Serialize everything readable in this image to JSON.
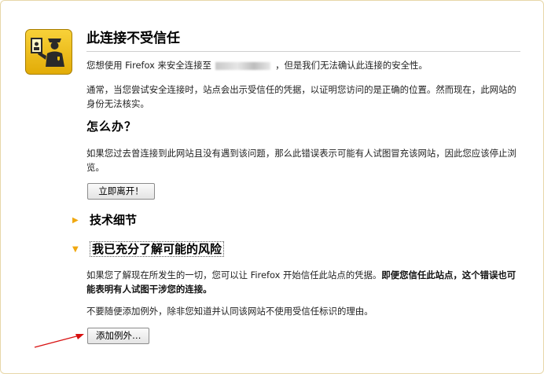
{
  "page": {
    "title": "此连接不受信任",
    "intro_before": "您想使用 Firefox 来安全连接至",
    "intro_after": "，但是我们无法确认此连接的安全性。",
    "normal_explanation": "通常，当您尝试安全连接时，站点会出示受信任的凭据，以证明您访问的是正确的位置。然而现在，此网站的身份无法核实。",
    "what_to_do_heading": "怎么办？",
    "what_to_do_text": "如果您过去曾连接到此网站且没有遇到该问题，那么此错误表示可能有人试图冒充该网站，因此您应该停止浏览。",
    "leave_button": "立即离开！",
    "technical_details": "技术细节",
    "understand_risks": "我已充分了解可能的风险",
    "risk_text_plain": "如果您了解现在所发生的一切，您可以让 Firefox 开始信任此站点的凭据。",
    "risk_text_bold": "即便您信任此站点，这个错误也可能表明有人试图干涉您的连接。",
    "exception_warning": "不要随便添加例外，除非您知道并认同该网站不使用受信任标识的理由。",
    "add_exception_button": "添加例外…"
  },
  "colors": {
    "accent_triangle": "#f0a810",
    "icon_yellow": "#f2c10a",
    "arrow_red": "#d81010"
  },
  "icons": {
    "main": "police-officer-id-icon",
    "expander_collapsed": "triangle-right-icon",
    "expander_expanded": "triangle-down-icon",
    "annotation": "red-arrow"
  }
}
